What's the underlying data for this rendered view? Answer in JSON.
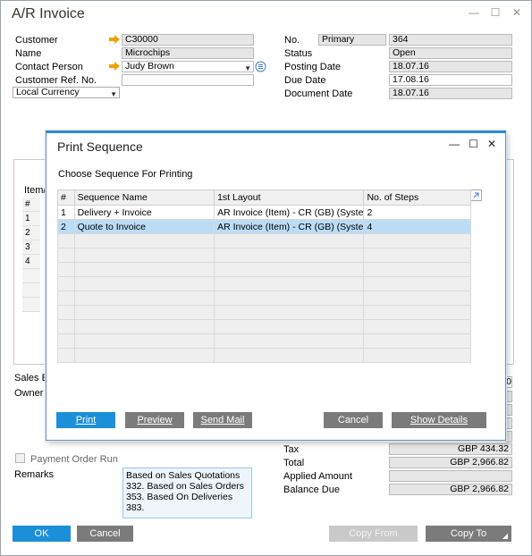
{
  "window": {
    "title": "A/R Invoice"
  },
  "header_left": {
    "customer_label": "Customer",
    "customer_value": "C30000",
    "name_label": "Name",
    "name_value": "Microchips",
    "contact_label": "Contact Person",
    "contact_value": "Judy Brown",
    "custref_label": "Customer Ref. No.",
    "custref_value": "",
    "currency_value": "Local Currency"
  },
  "header_right": {
    "no_label": "No.",
    "no_series": "Primary",
    "no_value": "364",
    "status_label": "Status",
    "status_value": "Open",
    "posting_label": "Posting Date",
    "posting_value": "18.07.16",
    "due_label": "Due Date",
    "due_value": "17.08.16",
    "document_label": "Document Date",
    "document_value": "18.07.16"
  },
  "background_grid": {
    "tab_label": "Item/",
    "rows": [
      "#",
      "1",
      "2",
      "3",
      "4"
    ]
  },
  "footer_left": {
    "sales_emp_label": "Sales En",
    "owner_label": "Owner",
    "payment_order_label": "Payment Order Run",
    "remarks_label": "Remarks",
    "remarks_lines": [
      "Based on Sales Quotations",
      "332. Based on Sales Orders",
      "353. Based On Deliveries 383."
    ]
  },
  "totals": {
    "tax_label": "Tax",
    "tax_value": "GBP 434.32",
    "total_label": "Total",
    "total_value": "GBP 2,966.82",
    "applied_label": "Applied Amount",
    "applied_value": "",
    "balance_label": "Balance Due",
    "balance_value": "GBP 2,966.82",
    "side_value": "0"
  },
  "bottom_buttons": {
    "ok": "OK",
    "cancel": "Cancel",
    "copy_from": "Copy From",
    "copy_to": "Copy To"
  },
  "dialog": {
    "title": "Print Sequence",
    "subtitle": "Choose Sequence For Printing",
    "columns": [
      "#",
      "Sequence Name",
      "1st Layout",
      "No. of Steps"
    ],
    "rows": [
      [
        "1",
        "Delivery + Invoice",
        "AR Invoice (Item) - CR (GB) (Syste",
        "2"
      ],
      [
        "2",
        "Quote to Invoice",
        "AR Invoice (Item) - CR (GB) (Syste",
        "4"
      ]
    ],
    "selected_row": 1,
    "buttons": {
      "print": "Print",
      "preview": "Preview",
      "send_mail": "Send Mail",
      "cancel": "Cancel",
      "show_details": "Show Details"
    }
  },
  "colors": {
    "accent": "#1c8fd9",
    "selection": "#bcdcf6",
    "button_grey": "#7b7b7b",
    "arrow": "#f0a000"
  }
}
